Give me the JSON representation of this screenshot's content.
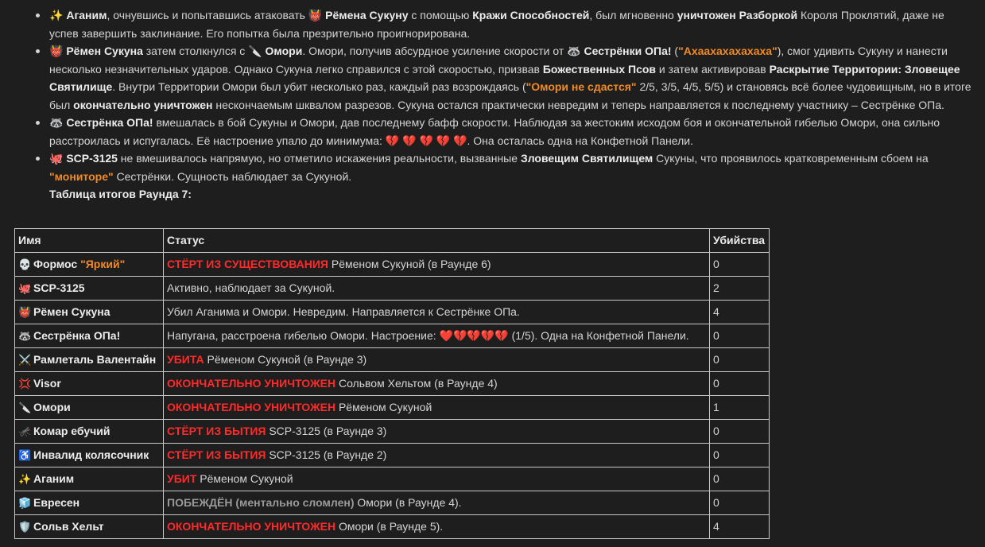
{
  "bullets": [
    {
      "icon": "✨",
      "icon_name": "sparkles-icon",
      "parts": [
        {
          "t": "Аганим",
          "s": "b"
        },
        {
          "t": ", очнувшись и попытавшись атаковать "
        },
        {
          "t": "👹",
          "s": "icon",
          "name": "ogre-icon"
        },
        {
          "t": " Рёмена Сукуну",
          "s": "b"
        },
        {
          "t": " с помощью "
        },
        {
          "t": "Кражи Способностей",
          "s": "b"
        },
        {
          "t": ", был мгновенно "
        },
        {
          "t": "уничтожен Разборкой",
          "s": "b"
        },
        {
          "t": " Короля Проклятий, даже не успев завершить заклинание. Его попытка была презрительно проигнорирована."
        }
      ]
    },
    {
      "icon": "👹",
      "icon_name": "ogre-icon",
      "parts": [
        {
          "t": "Рёмен Сукуна",
          "s": "b"
        },
        {
          "t": " затем столкнулся с "
        },
        {
          "t": "🔪",
          "s": "icon",
          "name": "knife-icon"
        },
        {
          "t": " Омори",
          "s": "b"
        },
        {
          "t": ". Омори, получив абсурдное усиление скорости от "
        },
        {
          "t": "🦝",
          "s": "icon",
          "name": "raccoon-icon"
        },
        {
          "t": " Сестрёнки ОПа!",
          "s": "b"
        },
        {
          "t": " ("
        },
        {
          "t": "\"Ахаахахахахаха\"",
          "s": "orange"
        },
        {
          "t": "), смог удивить Сукуну и нанести несколько незначительных ударов. Однако Сукуна легко справился с этой скоростью, призвав "
        },
        {
          "t": "Божественных Псов",
          "s": "b"
        },
        {
          "t": " и затем активировав "
        },
        {
          "t": "Раскрытие Территории: Зловещее Святилище",
          "s": "b"
        },
        {
          "t": ". Внутри Территории Омори был убит несколько раз, каждый раз возрождаясь ("
        },
        {
          "t": "\"Омори не сдастся\"",
          "s": "orange"
        },
        {
          "t": " 2/5, 3/5, 4/5, 5/5) и становясь всё более чудовищным, но в итоге был "
        },
        {
          "t": "окончательно уничтожен",
          "s": "b"
        },
        {
          "t": " нескончаемым шквалом разрезов. Сукуна остался практически невредим и теперь направляется к последнему участнику – Сестрёнке ОПа."
        }
      ]
    },
    {
      "icon": "🦝",
      "icon_name": "raccoon-icon",
      "parts": [
        {
          "t": "Сестрёнка ОПа!",
          "s": "b"
        },
        {
          "t": " вмешалась в бой Сукуны и Омори, дав последнему бафф скорости. Наблюдая за жестоким исходом боя и окончательной гибелью Омори, она сильно расстроилась и испугалась. Её настроение упало до минимума: "
        },
        {
          "t": "💔 💔 💔 💔 💔",
          "s": "heart",
          "name": "broken-hearts"
        },
        {
          "t": ". Она осталась одна на Конфетной Панели."
        }
      ]
    },
    {
      "icon": "🐙",
      "icon_name": "octopus-icon",
      "parts": [
        {
          "t": "SCP-3125",
          "s": "b"
        },
        {
          "t": " не вмешивалось напрямую, но отметило искажения реальности, вызванные "
        },
        {
          "t": "Зловещим Святилищем",
          "s": "b"
        },
        {
          "t": " Сукуны, что проявилось кратковременным сбоем на "
        },
        {
          "t": "\"мониторе\"",
          "s": "orange"
        },
        {
          "t": " Сестрёнки. Сущность наблюдает за Сукуной."
        }
      ]
    }
  ],
  "table_caption": "Таблица итогов Раунда 7:",
  "table": {
    "headers": [
      "Имя",
      "Статус",
      "Убийства"
    ],
    "rows": [
      {
        "icon": "💀",
        "icon_name": "skull-icon",
        "name": "Формос ",
        "name_extra": "\"Яркий\"",
        "status_hl": "СТЁРТ ИЗ СУЩЕСТВОВАНИЯ",
        "status_style": "red",
        "status_rest": " Рёменом Сукуной (в Раунде 6)",
        "kills": "0"
      },
      {
        "icon": "🐙",
        "icon_name": "octopus-icon",
        "name": "SCP-3125",
        "name_extra": "",
        "status_hl": "",
        "status_style": "",
        "status_rest": "Активно, наблюдает за Сукуной.",
        "kills": "2"
      },
      {
        "icon": "👹",
        "icon_name": "ogre-icon",
        "name": "Рёмен Сукуна",
        "name_extra": "",
        "status_hl": "",
        "status_style": "",
        "status_rest": "Убил Аганима и Омори. Невредим. Направляется к Сестрёнке ОПа.",
        "kills": "4"
      },
      {
        "icon": "🦝",
        "icon_name": "raccoon-icon",
        "name": "Сестрёнка ОПа!",
        "name_extra": "",
        "status_hl": "",
        "status_style": "",
        "status_rest": "Напугана, расстроена гибелью Омори. Настроение: ",
        "hearts": "❤️💔💔💔💔",
        "status_tail": " (1/5). Одна на Конфетной Панели.",
        "kills": "0"
      },
      {
        "icon": "⚔️",
        "icon_name": "crossed-swords-icon",
        "name": "Рамлеталь Валентайн",
        "name_extra": "",
        "status_hl": "УБИТА",
        "status_style": "red",
        "status_rest": " Рёменом Сукуной (в Раунде 3)",
        "kills": "0"
      },
      {
        "icon": "💢",
        "icon_name": "anger-symbol-icon",
        "name": "Visor",
        "name_extra": "",
        "status_hl": "ОКОНЧАТЕЛЬНО УНИЧТОЖЕН",
        "status_style": "red",
        "status_rest": " Сольвом Хельтом (в Раунде 4)",
        "kills": "0"
      },
      {
        "icon": "🔪",
        "icon_name": "knife-icon",
        "name": "Омори",
        "name_extra": "",
        "status_hl": "ОКОНЧАТЕЛЬНО УНИЧТОЖЕН",
        "status_style": "red",
        "status_rest": " Рёменом Сукуной",
        "kills": "1"
      },
      {
        "icon": "🦟",
        "icon_name": "mosquito-icon",
        "name": "Комар ебучий",
        "name_extra": "",
        "status_hl": "СТЁРТ ИЗ БЫТИЯ",
        "status_style": "red",
        "status_rest": " SCP-3125 (в Раунде 3)",
        "kills": "0"
      },
      {
        "icon": "♿",
        "icon_name": "wheelchair-icon",
        "name": "Инвалид колясочник",
        "name_extra": "",
        "status_hl": "СТЁРТ ИЗ БЫТИЯ",
        "status_style": "red",
        "status_rest": " SCP-3125 (в Раунде 2)",
        "kills": "0"
      },
      {
        "icon": "✨",
        "icon_name": "sparkles-icon",
        "name": "Аганим",
        "name_extra": "",
        "status_hl": "УБИТ",
        "status_style": "red",
        "status_rest": " Рёменом Сукуной",
        "kills": "0"
      },
      {
        "icon": "🧊",
        "icon_name": "ice-cube-icon",
        "name": "Евресен",
        "name_extra": "",
        "status_hl": "ПОБЕЖДЁН (ментально сломлен)",
        "status_style": "grey",
        "status_rest": " Омори (в Раунде 4).",
        "kills": "0"
      },
      {
        "icon": "🛡️",
        "icon_name": "shield-icon",
        "name": "Сольв Хельт",
        "name_extra": "",
        "status_hl": "ОКОНЧАТЕЛЬНО УНИЧТОЖЕН",
        "status_style": "red",
        "status_rest": " Омори (в Раунде 5).",
        "kills": "4"
      }
    ]
  }
}
